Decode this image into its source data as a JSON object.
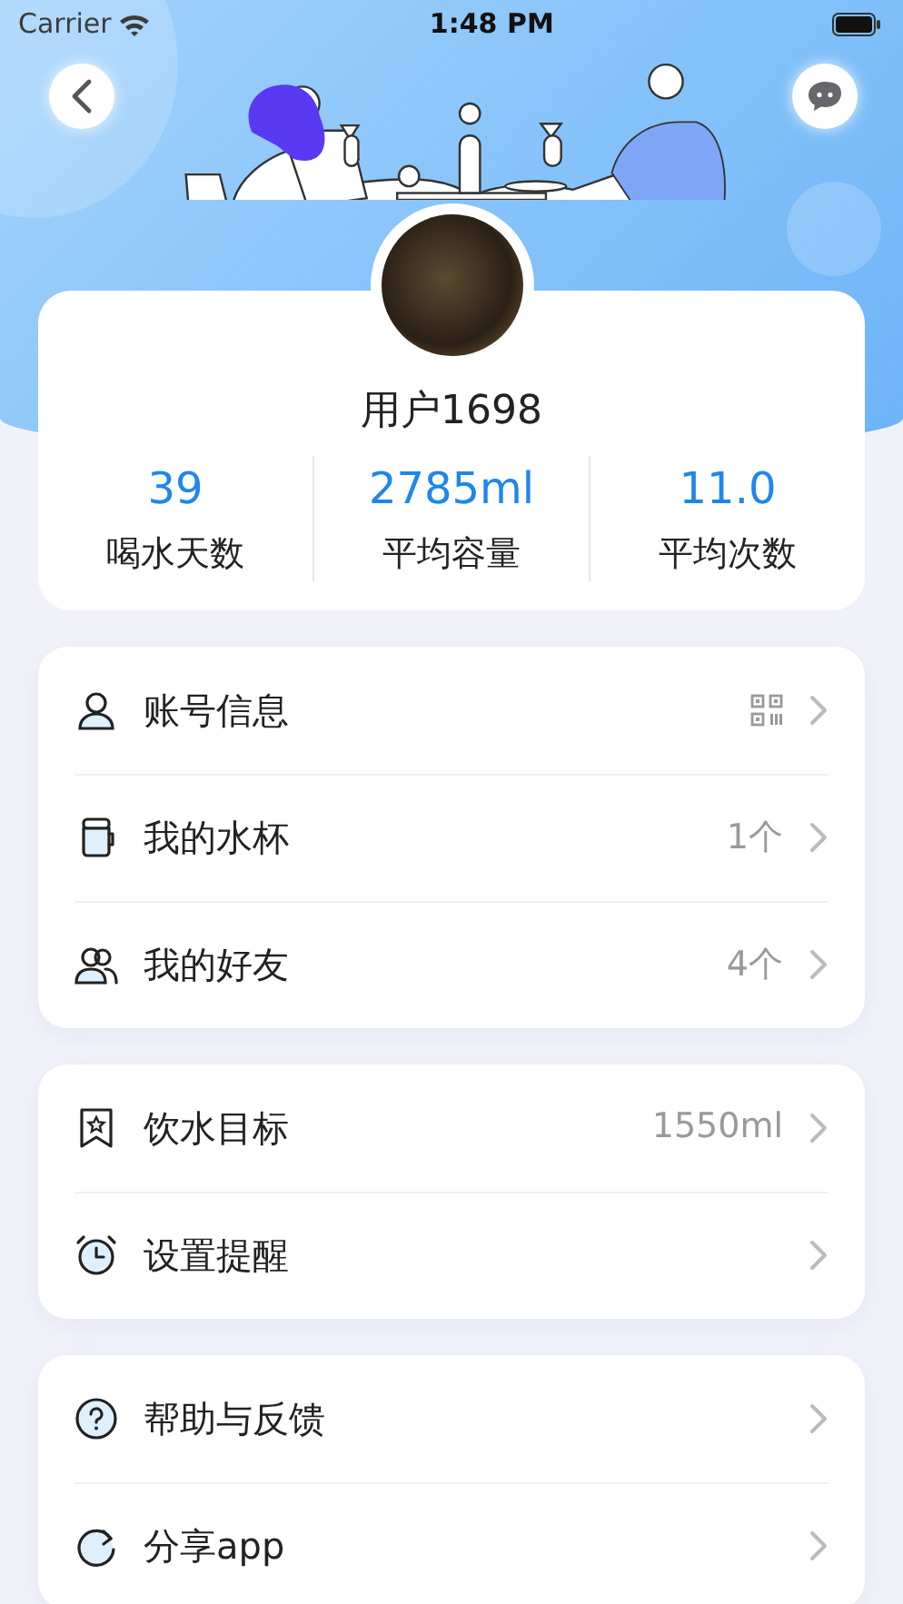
{
  "status_bar": {
    "carrier": "Carrier",
    "time": "1:48 PM"
  },
  "profile": {
    "username": "用户1698",
    "stats": [
      {
        "value": "39",
        "label": "喝水天数"
      },
      {
        "value": "2785ml",
        "label": "平均容量"
      },
      {
        "value": "11.0",
        "label": "平均次数"
      }
    ]
  },
  "menu_groups": [
    {
      "items": [
        {
          "kind": "account",
          "label": "账号信息"
        },
        {
          "kind": "cup",
          "label": "我的水杯",
          "value": "1个"
        },
        {
          "kind": "friends",
          "label": "我的好友",
          "value": "4个"
        }
      ]
    },
    {
      "items": [
        {
          "kind": "goal",
          "label": "饮水目标",
          "value": "1550ml"
        },
        {
          "kind": "reminder",
          "label": "设置提醒"
        }
      ]
    },
    {
      "items": [
        {
          "kind": "help",
          "label": "帮助与反馈"
        },
        {
          "kind": "share",
          "label": "分享app"
        }
      ]
    }
  ]
}
